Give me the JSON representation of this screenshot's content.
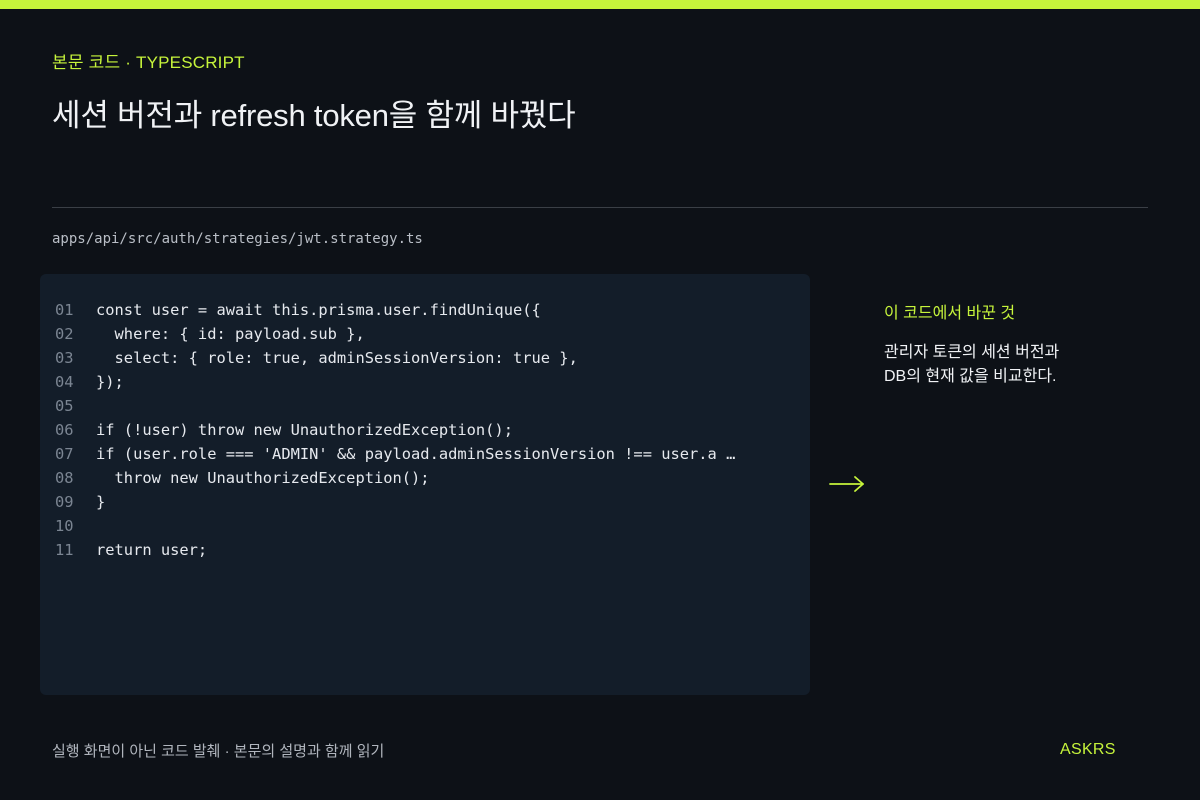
{
  "header": {
    "eyebrow": "본문 코드 · TYPESCRIPT",
    "title": "세션 버전과 refresh token을 함께 바꿨다"
  },
  "code": {
    "file_path": "apps/api/src/auth/strategies/jwt.strategy.ts",
    "lines": [
      {
        "number": "01",
        "text": "const user = await this.prisma.user.findUnique({"
      },
      {
        "number": "02",
        "text": "  where: { id: payload.sub },"
      },
      {
        "number": "03",
        "text": "  select: { role: true, adminSessionVersion: true },"
      },
      {
        "number": "04",
        "text": "});"
      },
      {
        "number": "05",
        "text": ""
      },
      {
        "number": "06",
        "text": "if (!user) throw new UnauthorizedException();"
      },
      {
        "number": "07",
        "text": "if (user.role === 'ADMIN' && payload.adminSessionVersion !== user.a …"
      },
      {
        "number": "08",
        "text": "  throw new UnauthorizedException();"
      },
      {
        "number": "09",
        "text": "}"
      },
      {
        "number": "10",
        "text": ""
      },
      {
        "number": "11",
        "text": "return user;"
      }
    ]
  },
  "annotation": {
    "title": "이 코드에서 바꾼 것",
    "body_lines": [
      "관리자 토큰의 세션 버전과",
      "DB의 현재 값을 비교한다."
    ],
    "arrow_icon": "arrow-right-icon"
  },
  "footer": {
    "caption": "실행 화면이 아닌 코드 발췌 · 본문의 설명과 함께 읽기",
    "brand": "ASKRS"
  },
  "colors": {
    "background": "#0d1117",
    "accent": "#c6f43b",
    "code_panel": "#131d29",
    "line_number": "#7b8592",
    "code_text": "#e6e9ee"
  }
}
